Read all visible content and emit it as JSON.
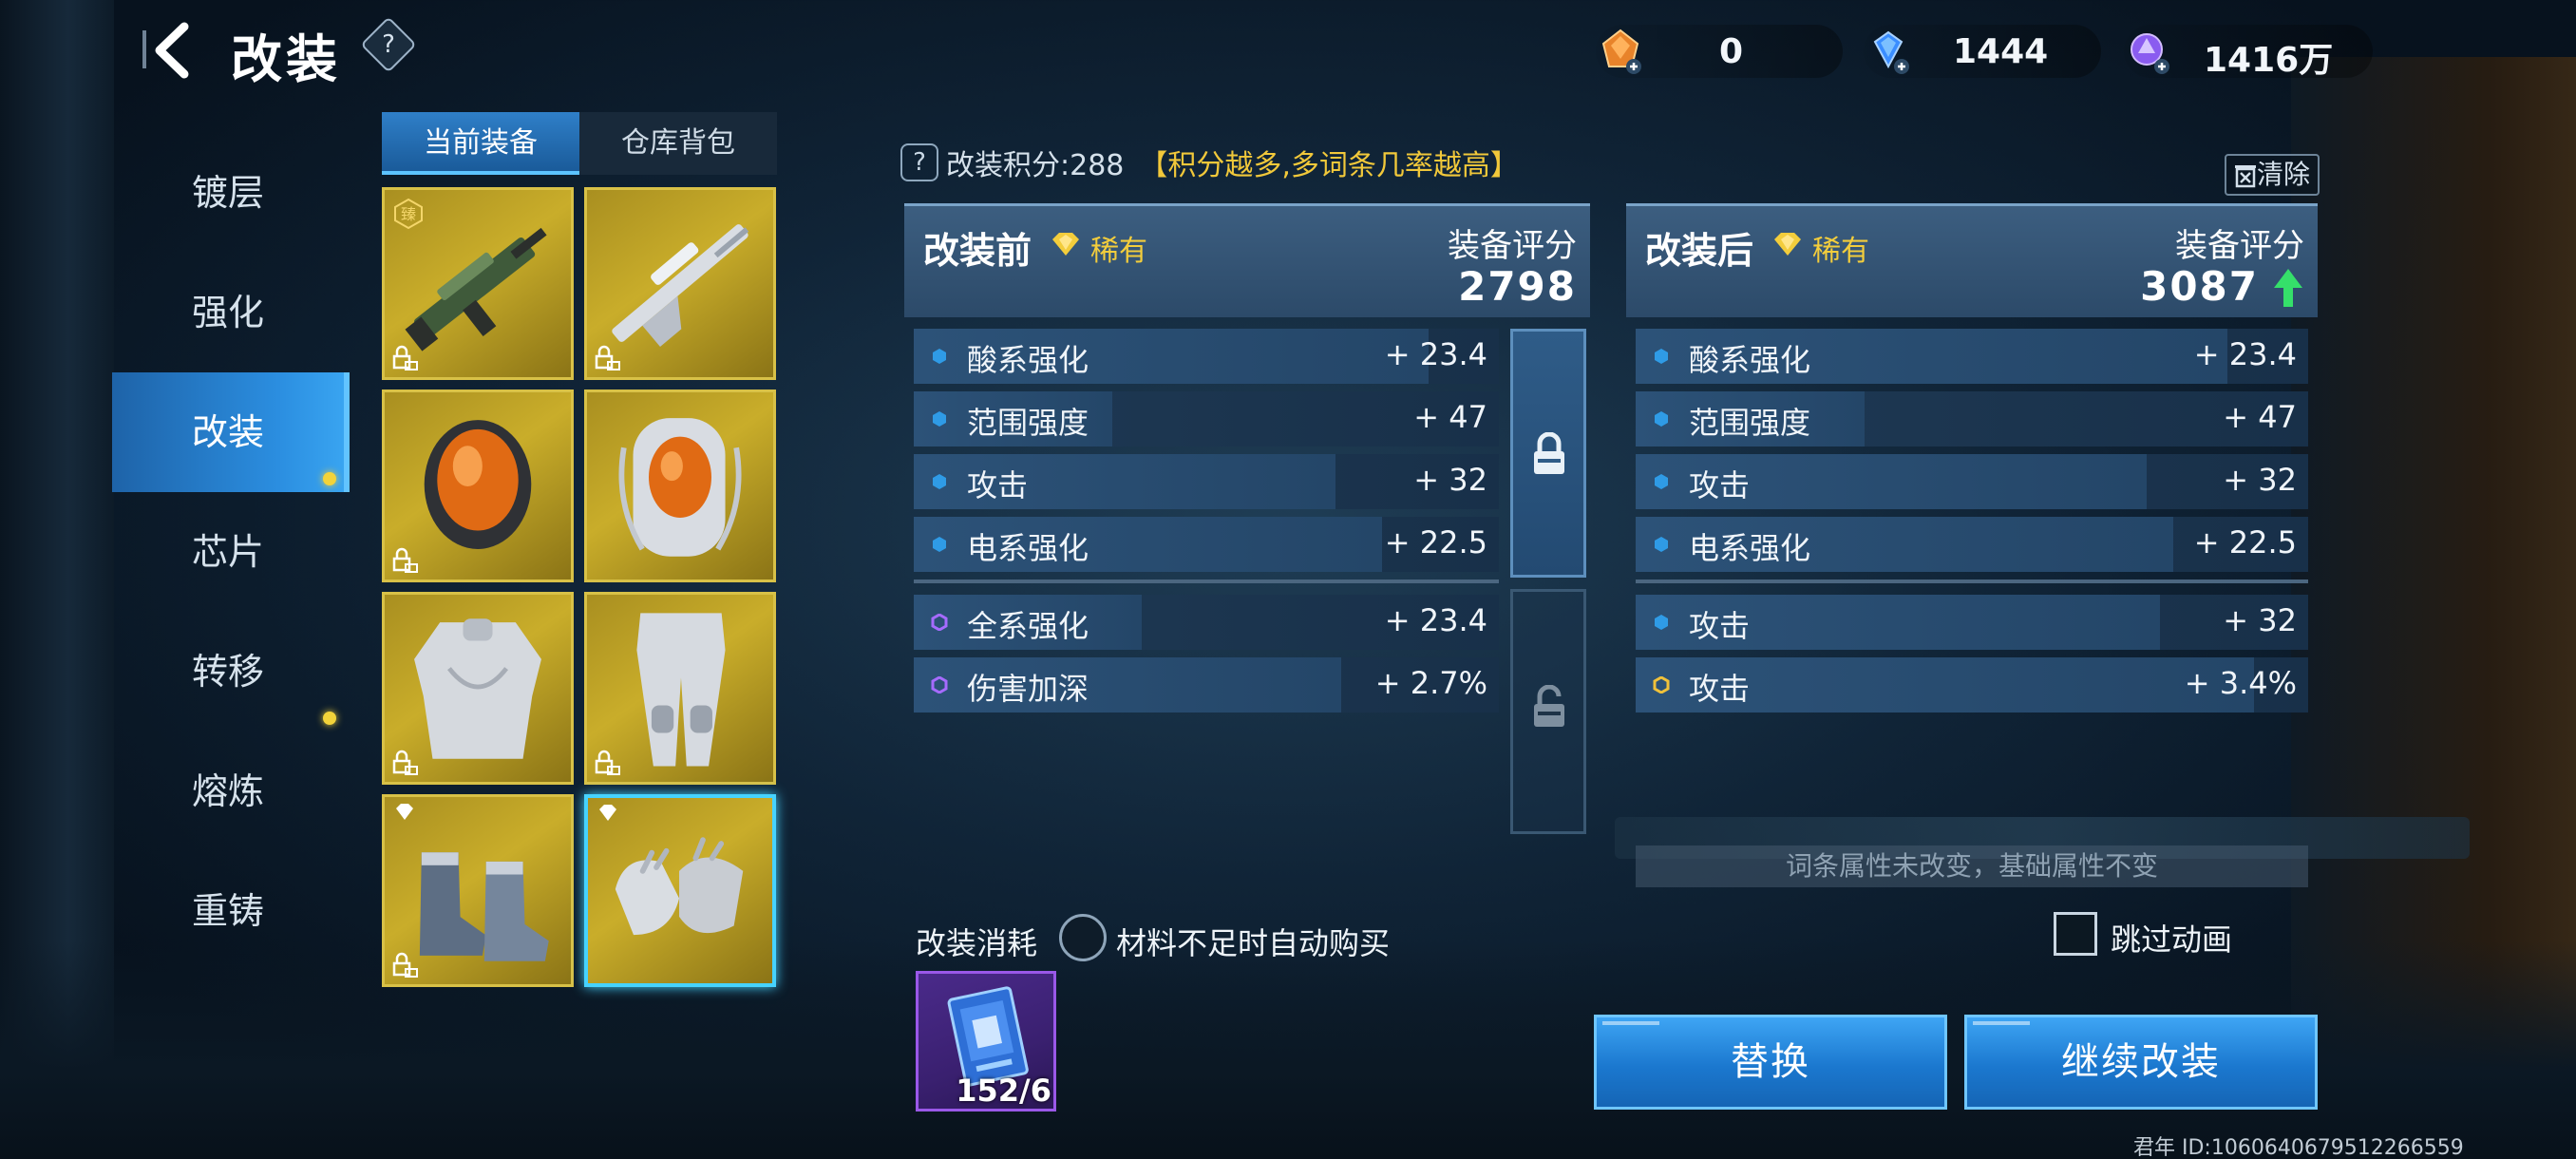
{
  "header": {
    "title": "改装",
    "help_label": "?",
    "currencies": [
      {
        "name": "orange-crystal",
        "value": "0",
        "color": "#e8832a"
      },
      {
        "name": "blue-diamond",
        "value": "1444",
        "color": "#3a8dff"
      },
      {
        "name": "purple-orb",
        "value": "1416万",
        "color": "#9c6cff"
      }
    ]
  },
  "sidebar": {
    "items": [
      {
        "label": "镀层",
        "active": false,
        "dot": false
      },
      {
        "label": "强化",
        "active": false,
        "dot": false
      },
      {
        "label": "改装",
        "active": true,
        "dot": true
      },
      {
        "label": "芯片",
        "active": false,
        "dot": false
      },
      {
        "label": "转移",
        "active": false,
        "dot": true
      },
      {
        "label": "熔炼",
        "active": false,
        "dot": false
      },
      {
        "label": "重铸",
        "active": false,
        "dot": false
      }
    ]
  },
  "equipment": {
    "tabs": [
      {
        "label": "当前装备",
        "active": true
      },
      {
        "label": "仓库背包",
        "active": false
      }
    ],
    "slots": [
      {
        "item": "rifle",
        "badge": "hex",
        "badge_text": "臻"
      },
      {
        "item": "sniper",
        "badge": "",
        "badge_text": ""
      },
      {
        "item": "helmet",
        "badge": "",
        "badge_text": ""
      },
      {
        "item": "backpack",
        "badge": "",
        "badge_text": ""
      },
      {
        "item": "chest-armor",
        "badge": "",
        "badge_text": ""
      },
      {
        "item": "leg-armor",
        "badge": "",
        "badge_text": ""
      },
      {
        "item": "boots",
        "badge": "diamond",
        "badge_text": ""
      },
      {
        "item": "gloves",
        "badge": "diamond",
        "badge_text": "",
        "selected": true
      }
    ]
  },
  "mod": {
    "points_label": "改装积分:288",
    "points_hint": "【积分越多,多词条几率越高】",
    "clear_label": "清除",
    "before": {
      "title": "改装前",
      "rarity": "稀有",
      "score_label": "装备评分",
      "score": "2798",
      "attrs_top": [
        {
          "name": "酸系强化",
          "value": "+ 23.4",
          "fill": 0.88,
          "dot": "blue"
        },
        {
          "name": "范围强度",
          "value": "+ 47",
          "fill": 0.34,
          "dot": "blue"
        },
        {
          "name": "攻击",
          "value": "+ 32",
          "fill": 0.72,
          "dot": "blue"
        },
        {
          "name": "电系强化",
          "value": "+ 22.5",
          "fill": 0.8,
          "dot": "blue"
        }
      ],
      "attrs_bottom": [
        {
          "name": "全系强化",
          "value": "+ 23.4",
          "fill": 0.39,
          "dot": "purple"
        },
        {
          "name": "伤害加深",
          "value": "+ 2.7%",
          "fill": 0.73,
          "dot": "purple"
        }
      ]
    },
    "after": {
      "title": "改装后",
      "rarity": "稀有",
      "score_label": "装备评分",
      "score": "3087",
      "attrs_top": [
        {
          "name": "酸系强化",
          "value": "+ 23.4",
          "fill": 0.88,
          "dot": "blue"
        },
        {
          "name": "范围强度",
          "value": "+ 47",
          "fill": 0.34,
          "dot": "blue"
        },
        {
          "name": "攻击",
          "value": "+ 32",
          "fill": 0.76,
          "dot": "blue"
        },
        {
          "name": "电系强化",
          "value": "+ 22.5",
          "fill": 0.8,
          "dot": "blue"
        }
      ],
      "attrs_bottom": [
        {
          "name": "攻击",
          "value": "+ 32",
          "fill": 0.78,
          "dot": "blue"
        },
        {
          "name": "攻击",
          "value": "+ 3.4%",
          "fill": 0.92,
          "dot": "gold"
        }
      ]
    },
    "note": "词条属性未改变，基础属性不变"
  },
  "bottom": {
    "cost_label": "改装消耗",
    "auto_buy_label": "材料不足时自动购买",
    "skip_anim_label": "跳过动画",
    "material_count": "152/6",
    "replace_label": "替换",
    "continue_label": "继续改装"
  },
  "footer": {
    "id_text": "君年  ID:1060640679512266559"
  },
  "colors": {
    "accent": "#2b8ee0",
    "gold": "#f3cd3c",
    "dot_blue": "#2f9be6",
    "dot_purple": "#a66bff",
    "dot_gold": "#f0c13a"
  }
}
